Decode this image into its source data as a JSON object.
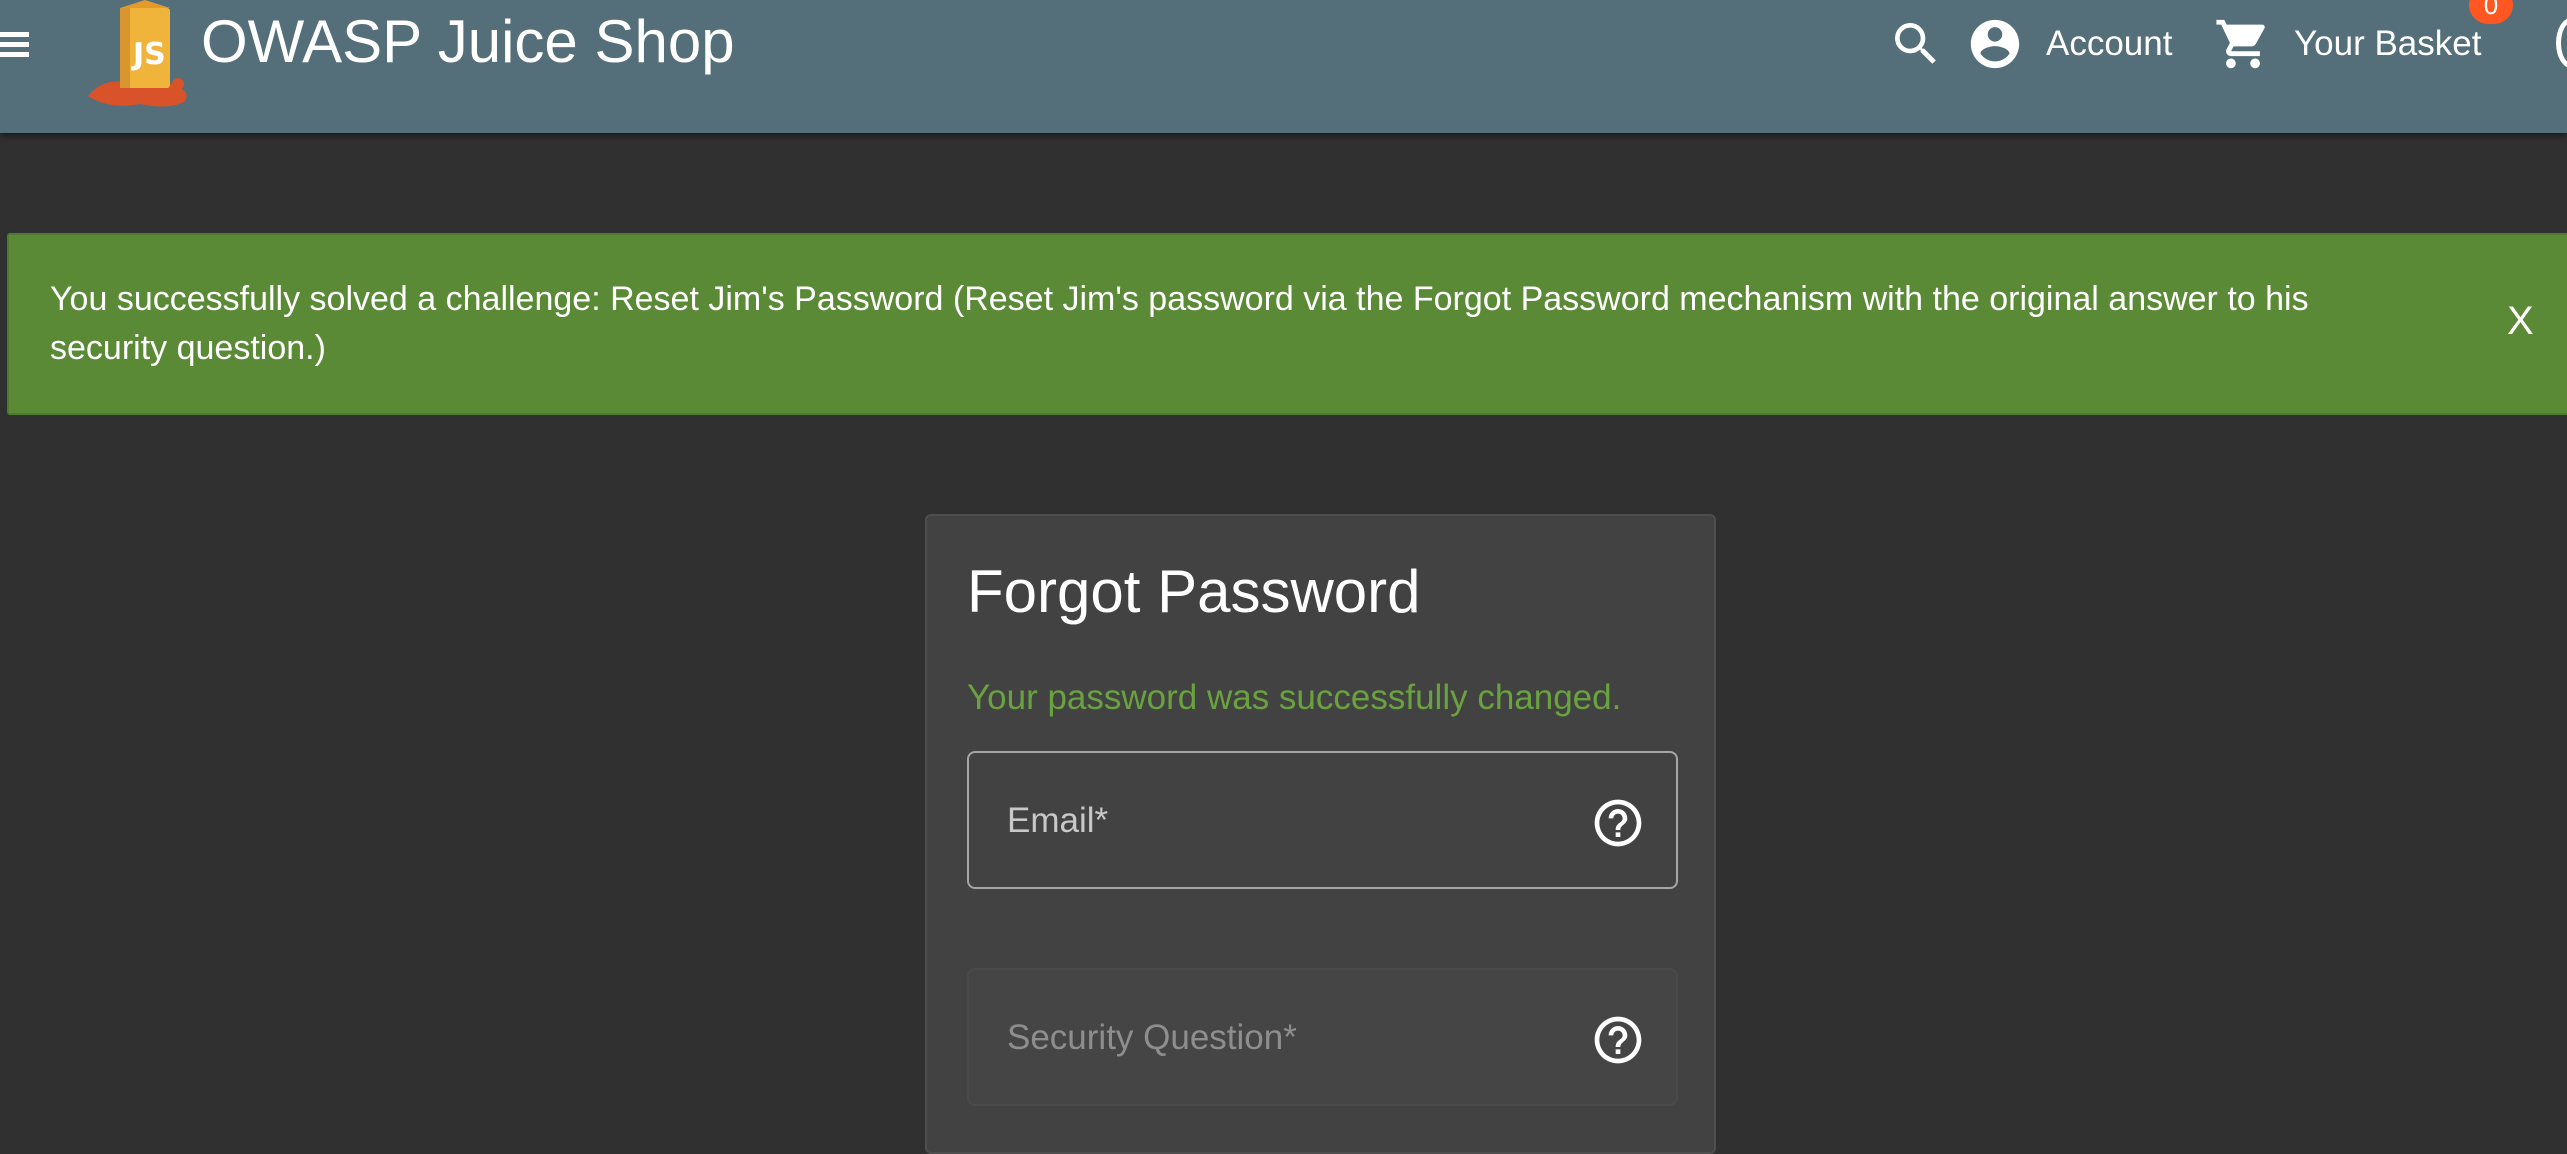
{
  "header": {
    "title": "OWASP Juice Shop",
    "logo_text": "JS",
    "account_label": "Account",
    "basket_label": "Your Basket",
    "basket_count": "0",
    "icons": {
      "menu": "menu-icon",
      "search": "search-icon",
      "account": "account-circle-icon",
      "basket": "shopping-cart-icon",
      "language": "language-icon"
    }
  },
  "notification": {
    "text": "You successfully solved a challenge: Reset Jim's Password (Reset Jim's password via the Forgot Password mechanism with the original answer to his security question.)",
    "close_label": "X"
  },
  "form": {
    "title": "Forgot Password",
    "success_message": "Your password was successfully changed.",
    "fields": [
      {
        "label": "Email*",
        "help_icon": "help-icon"
      },
      {
        "label": "Security Question*",
        "help_icon": "help-icon"
      }
    ]
  },
  "colors": {
    "toolbar": "#546e7a",
    "background": "#303030",
    "card": "#424242",
    "notification": "#5a8a36",
    "success_text": "#69a23f",
    "badge": "#ff5722"
  }
}
